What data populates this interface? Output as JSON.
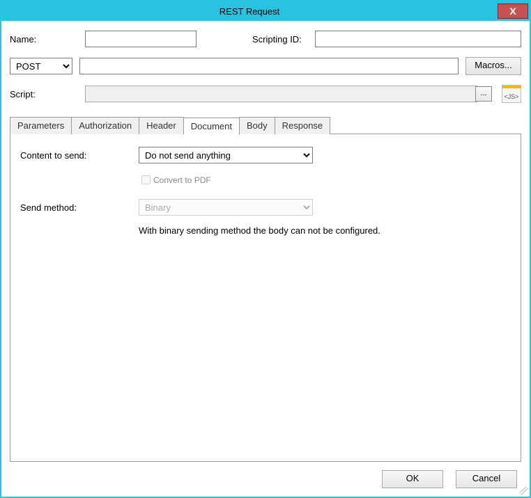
{
  "window": {
    "title": "REST Request",
    "close_glyph": "X"
  },
  "labels": {
    "name": "Name:",
    "scripting_id": "Scripting ID:",
    "script": "Script:",
    "macros": "Macros...",
    "ellipsis": "...",
    "js": "<JS>"
  },
  "fields": {
    "name_value": "",
    "scripting_id_value": "",
    "url_value": "",
    "script_value": ""
  },
  "method": {
    "selected": "POST"
  },
  "tabs": {
    "items": [
      {
        "label": "Parameters"
      },
      {
        "label": "Authorization"
      },
      {
        "label": "Header"
      },
      {
        "label": "Document"
      },
      {
        "label": "Body"
      },
      {
        "label": "Response"
      }
    ],
    "active": "Document"
  },
  "document_tab": {
    "content_to_send_label": "Content to send:",
    "content_to_send_value": "Do not send anything",
    "convert_to_pdf_label": "Convert to PDF",
    "convert_to_pdf_checked": false,
    "send_method_label": "Send method:",
    "send_method_value": "Binary",
    "hint": "With binary sending method the body can not be configured."
  },
  "buttons": {
    "ok": "OK",
    "cancel": "Cancel"
  }
}
